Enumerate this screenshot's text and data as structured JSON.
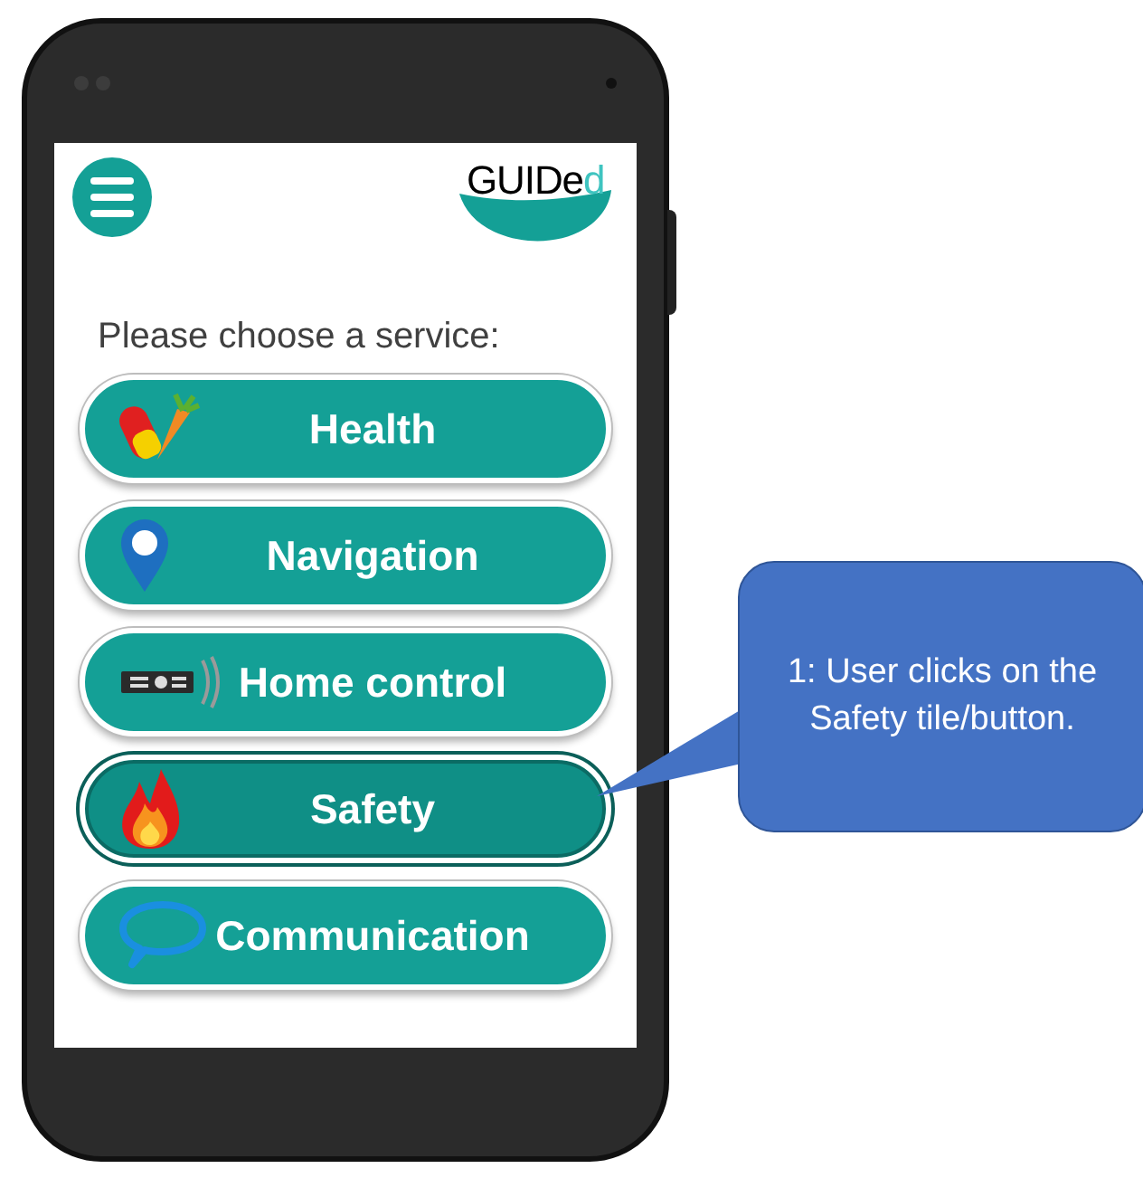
{
  "header": {
    "logo": {
      "text": "GUIDe",
      "accent": "d"
    }
  },
  "prompt": "Please choose a service:",
  "services": [
    {
      "label": "Health",
      "kind": "health",
      "selected": false
    },
    {
      "label": "Navigation",
      "kind": "navigation",
      "selected": false
    },
    {
      "label": "Home control",
      "kind": "home",
      "selected": false
    },
    {
      "label": "Safety",
      "kind": "safety",
      "selected": true
    },
    {
      "label": "Communication",
      "kind": "communication",
      "selected": false
    }
  ],
  "callout": {
    "text": "1: User clicks on the Safety tile/button."
  }
}
